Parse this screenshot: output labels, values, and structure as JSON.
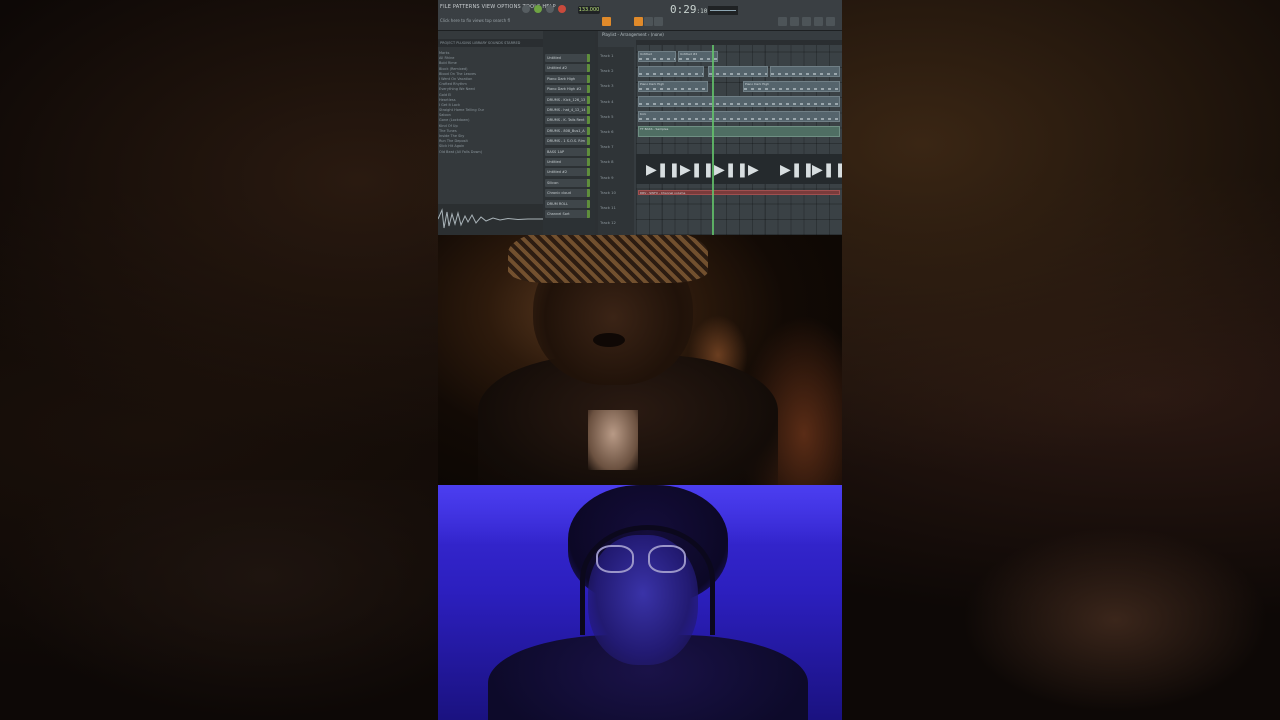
{
  "toolbar": {
    "menu_text": "FILE PATTERNS VIEW OPTIONS TOOLS HELP",
    "hint_text": "Click here to fix views top search fl",
    "song_time": "0:29",
    "song_time_fraction": ":10",
    "tempo": "133.000"
  },
  "browser": {
    "tab_labels": "PROJECT  PLUGINS  LIBRARY  SOUNDS  STARRED",
    "items": [
      "Marks",
      "All Rhine",
      "Bold Rime",
      "Block (Remixed)",
      "Blood On The Leaves",
      "I Went On Vacation",
      "Crafted Rhythm",
      "Everything We Need",
      "Gold El",
      "Heartless",
      "I Get It Lock",
      "Straight Home Telling Our",
      "Saloon",
      "Gone (Lockdown)",
      "Kind Of Up",
      "The Tunes",
      "Inside The Sky",
      "Run The Deposit",
      "Slick Hit Again",
      "Old Beat (All Falls Down)"
    ]
  },
  "channels": [
    "Untitled",
    "Untitled #2",
    "Piano Dark High",
    "Piano Dark High #2",
    "DRUMS - Kick_126_13",
    "DRUMS - hat_4_12_14",
    "DRUMS - K. Tails Rent",
    "DRUMS - 808_Bus1_A",
    "DRUMS - 1 S.O.S. Rim",
    "BASS 1AP",
    "Untitled",
    "Untitled #2",
    "Silicon",
    "Chronic cloud",
    "DRUM ROLL",
    "Channel Sort"
  ],
  "playlist": {
    "title": "Playlist - Arrangement › (none)",
    "tracks": [
      "Track 1",
      "Track 2",
      "Track 3",
      "Track 4",
      "Track 5",
      "Track 6",
      "Track 7",
      "Track 8",
      "Track 9",
      "Track 10",
      "Track 11",
      "Track 12"
    ],
    "clip_labels": {
      "c1": "Untitled",
      "c2": "Untitled #2",
      "c3": "Piano Dark High",
      "c4": "Piano Dark High",
      "c5": "TT BASS - Samples",
      "c6": "Kick",
      "c7": "DRV - SWFX - Channel volume"
    }
  },
  "colors": {
    "daw_bg": "#2c3033",
    "playhead": "#64c36b",
    "accent_orange": "#e08a2a"
  }
}
